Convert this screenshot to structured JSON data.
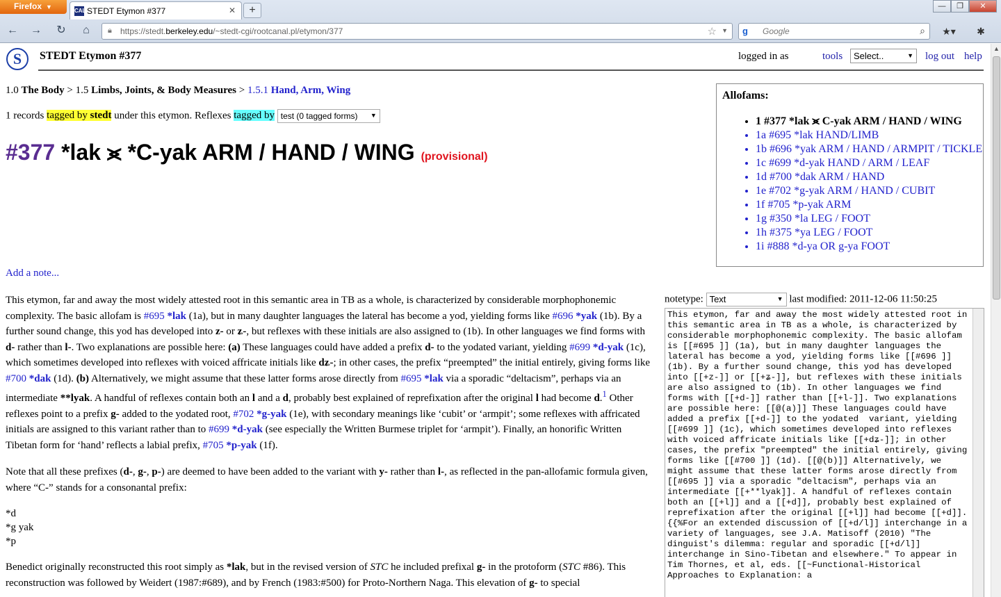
{
  "browser": {
    "app_button": "Firefox",
    "tab_title": "STEDT Etymon #377",
    "url_prefix": "https://stedt.",
    "url_host": "berkeley.edu",
    "url_path": "/~stedt-cgi/rootcanal.pl/etymon/377",
    "search_placeholder": "Google"
  },
  "header": {
    "site_title": "STEDT Etymon #377",
    "logged_in": "logged in as",
    "tools": "tools",
    "tools_select": "Select..",
    "logout": "log out",
    "help": "help"
  },
  "breadcrumb": {
    "c1_num": "1.0",
    "c1_name": "The Body",
    "c2_num": "1.5",
    "c2_name": "Limbs, Joints, & Body Measures",
    "c3_num": "1.5.1",
    "c3_name": "Hand, Arm, Wing"
  },
  "records": {
    "count_text": "1 records",
    "tagged_by": "tagged by",
    "tagger": "stedt",
    "under_text": "under this etymon. Reflexes",
    "reflex_tagged_by": "tagged by",
    "tag_select": "test (0 tagged forms)"
  },
  "etymon": {
    "number": "#377",
    "form": "*lak ⪤ *C-yak ARM / HAND / WING",
    "status": "(provisional)"
  },
  "allofams": {
    "title": "Allofams:",
    "items": [
      "1 #377 *lak ⪤ C-yak ARM / HAND / WING",
      "1a #695 *lak HAND/LIMB",
      "1b #696 *yak ARM / HAND / ARMPIT / TICKLE",
      "1c #699 *d-yak HAND / ARM / LEAF",
      "1d #700 *dak ARM / HAND",
      "1e #702 *g-yak ARM / HAND / CUBIT",
      "1f #705 *p-yak ARM",
      "1g #350 *la LEG / FOOT",
      "1h #375 *ya LEG / FOOT",
      "1i #888 *d-ya OR g-ya FOOT"
    ]
  },
  "add_note": "Add a note...",
  "note": {
    "notetype_label": "notetype:",
    "notetype_value": "Text",
    "last_modified": "last modified: 2011-12-06 11:50:25",
    "source": "This etymon, far and away the most widely attested root in this semantic area in TB as a whole, is characterized by considerable morphophonemic complexity. The basic allofam is [[#695 ]] (1a), but in many daughter languages the lateral has become a yod, yielding forms like [[#696 ]] (1b). By a further sound change, this yod has developed into [[+z-]] or [[+ʑ-]], but reflexes with these initials are also assigned to (1b). In other languages we find forms with [[+d-]] rather than [[+l-]]. Two explanations are possible here: [[@(a)]] These languages could have added a prefix [[+d-]] to the yodated  variant, yielding [[#699 ]] (1c), which sometimes developed into reflexes with voiced affricate initials like [[+dʑ-]]; in other cases, the prefix \"preempted\" the initial entirely, giving forms like [[#700 ]] (1d). [[@(b)]] Alternatively, we might assume that these latter forms arose directly from [[#695 ]] via a sporadic \"deltacism\", perhaps via an intermediate [[+**lyak]]. A handful of reflexes contain both an [[+l]] and a [[+d]], probably best explained of reprefixation after the original [[+l]] had become [[+d]].{{%For an extended discussion of [[+d/l]] interchange in a variety of languages, see J.A. Matisoff (2010) \"The dinguist's dilemma: regular and sporadic [[+d/l]] interchange in Sino-Tibetan and elsewhere.\" To appear in Tim Thornes, et al, eds. [[~Functional-Historical Approaches to Explanation: a"
  },
  "body": {
    "p1": {
      "s1": "This etymon, far and away the most widely attested root in this semantic area in TB as a whole, is characterized by considerable morphophonemic complexity. The basic allofam is",
      "l695": "#695",
      "l695f": "*lak",
      "s2": "(1a), but in many daughter languages the lateral has become a yod, yielding forms like",
      "l696": "#696",
      "l696f": "*yak",
      "s3": "(1b). By a further sound change, this yod has developed into",
      "z1": "z-",
      "s4": "or",
      "z2": "ʑ-",
      "s5": ", but reflexes with these initials are also assigned to (1b). In other languages we find forms with",
      "d1": "d-",
      "s6": "rather than",
      "l1": "l-",
      "s7": ". Two explanations are possible here:",
      "a": "(a)",
      "s8": "These languages could have added a prefix",
      "d2": "d-",
      "s9": "to the yodated variant, yielding",
      "l699": "#699",
      "l699f": "*d-yak",
      "s10": "(1c), which sometimes developed into reflexes with voiced affricate initials like",
      "dz": "dʑ-",
      "s11": "; in other cases, the prefix “preempted” the initial entirely, giving forms like",
      "l700": "#700",
      "l700f": "*dak",
      "s12": "(1d).",
      "b": "(b)",
      "s13": "Alternatively, we might assume that these latter forms arose directly from",
      "l695b": "#695",
      "l695bf": "*lak",
      "s14": "via a sporadic “deltacism”, perhaps via an intermediate",
      "lyak": "**lyak",
      "s15": ". A handful of reflexes contain both an",
      "l_": "l",
      "s16": "and a",
      "d_": "d",
      "s17": ", probably best explained of reprefixation after the original",
      "l__": "l",
      "s18": "had become",
      "d__": "d",
      "s19": ".",
      "fn": "1",
      "s20": "Other reflexes point to a prefix",
      "g1": "g-",
      "s21": "added to the yodated root,",
      "l702": "#702",
      "l702f": "*g-yak",
      "s22": "(1e), with secondary meanings like ‘cubit’ or ‘armpit’; some reflexes with affricated initials are assigned to this variant rather than to",
      "l699b": "#699",
      "l699bf": "*d-yak",
      "s23": "(see especially the Written Burmese triplet for ‘armpit’). Finally, an honorific Written Tibetan form for ‘hand’ reflects a labial prefix,",
      "l705": "#705",
      "l705f": "*p-yak",
      "s24": "(1f)."
    },
    "p2": {
      "s1": "Note that all these prefixes (",
      "d": "d-",
      "g": "g-",
      "p": "p-",
      "s2": ") are deemed to have been added to the variant with",
      "y": "y-",
      "s3": "rather than",
      "l": "l-",
      "s4": ", as reflected in the pan-allofamic formula given, where “C-” stands for a consonantal prefix:"
    },
    "formula": [
      "*d",
      "*g yak",
      "*p"
    ],
    "p3": {
      "s1": "Benedict originally reconstructed this root simply as",
      "lak": "*lak",
      "s2": ", but in the revised version of",
      "stc1": "STC",
      "s3": "he included prefixal",
      "g": "g-",
      "s4": "in the protoform (",
      "stc2": "STC",
      "s5": "#86). This reconstruction was followed by Weidert (1987:#689), and by French (1983:#500) for Proto-Northern Naga. This elevation of",
      "g2": "g-",
      "s6": "to special"
    }
  }
}
